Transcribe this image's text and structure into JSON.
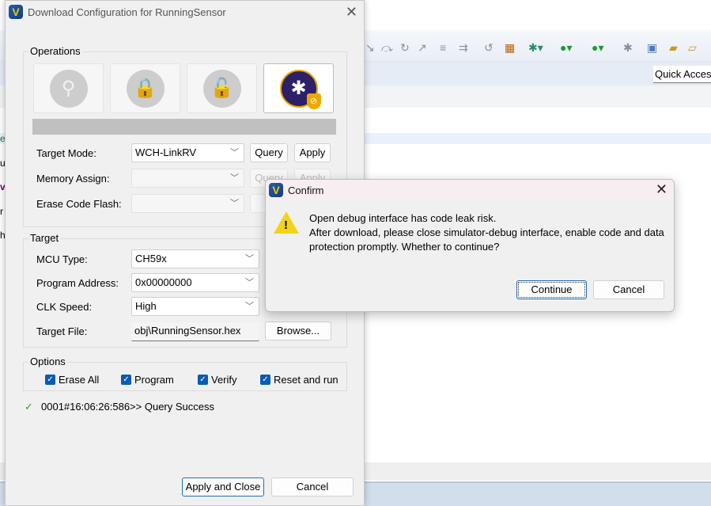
{
  "ide": {
    "quick_access": "Quick Access",
    "left_fragments": [
      "e",
      "u",
      "v",
      "r",
      "h"
    ]
  },
  "download_dialog": {
    "title": "Download Configuration for RunningSensor",
    "operations": {
      "label": "Operations",
      "buttons": [
        {
          "icon": "query-read-icon",
          "enabled": false
        },
        {
          "icon": "lock-protect-icon",
          "enabled": false
        },
        {
          "icon": "unlock-icon",
          "enabled": false
        },
        {
          "icon": "debug-bug-shield-icon",
          "enabled": true
        }
      ],
      "target_mode_label": "Target Mode:",
      "target_mode_value": "WCH-LinkRV",
      "memory_assign_label": "Memory Assign:",
      "erase_code_flash_label": "Erase Code Flash:",
      "query": "Query",
      "apply": "Apply"
    },
    "target": {
      "label": "Target",
      "mcu_type_label": "MCU Type:",
      "mcu_type_value": "CH59x",
      "program_address_label": "Program Address:",
      "program_address_value": "0x00000000",
      "clk_speed_label": "CLK Speed:",
      "clk_speed_value": "High",
      "target_file_label": "Target File:",
      "target_file_value": "obj\\RunningSensor.hex",
      "browse": "Browse..."
    },
    "options": {
      "label": "Options",
      "items": [
        {
          "label": "Erase All",
          "checked": true
        },
        {
          "label": "Program",
          "checked": true
        },
        {
          "label": "Verify",
          "checked": true
        },
        {
          "label": "Reset and run",
          "checked": true
        }
      ]
    },
    "log": "0001#16:06:26:586>> Query Success",
    "apply_and_close": "Apply and Close",
    "cancel": "Cancel"
  },
  "confirm_dialog": {
    "title": "Confirm",
    "line1": "Open debug interface has code leak risk.",
    "line2": "After download, please close simulator-debug interface, enable code and data protection promptly. Whether to continue?",
    "continue": "Continue",
    "cancel": "Cancel"
  }
}
